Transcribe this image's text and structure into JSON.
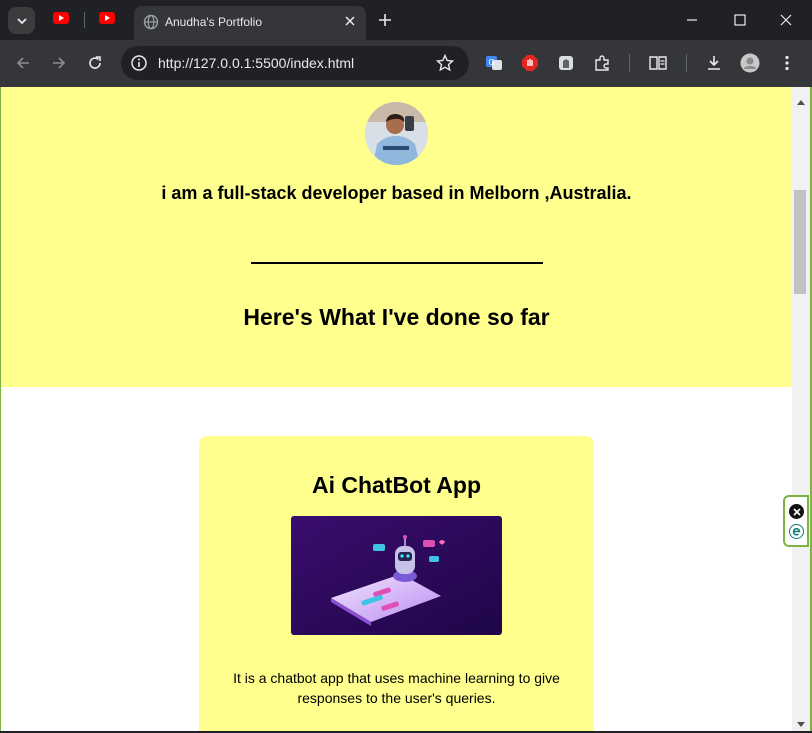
{
  "browser": {
    "active_tab_title": "Anudha's Portfolio",
    "url": "http://127.0.0.1:5500/index.html"
  },
  "page": {
    "tagline": "i am a full-stack developer based in Melborn ,Australia.",
    "section_title": "Here's What I've done so far",
    "project": {
      "title": "Ai ChatBot App",
      "description": "It is a chatbot app that uses machine learning to give responses to the user's queries."
    }
  },
  "colors": {
    "hero_bg": "#ffff8d",
    "chrome_dark": "#202124",
    "chrome_toolbar": "#35363a",
    "window_edge": "#7cb342"
  },
  "icons": [
    "tab-search-icon",
    "youtube-icon",
    "globe-icon",
    "close-icon",
    "plus-icon",
    "minimize-icon",
    "maximize-icon",
    "window-close-icon",
    "back-icon",
    "forward-icon",
    "reload-icon",
    "info-icon",
    "star-icon",
    "translate-icon",
    "adblock-icon",
    "extension-icon",
    "puzzle-icon",
    "reading-list-icon",
    "download-icon",
    "profile-icon",
    "more-icon"
  ]
}
